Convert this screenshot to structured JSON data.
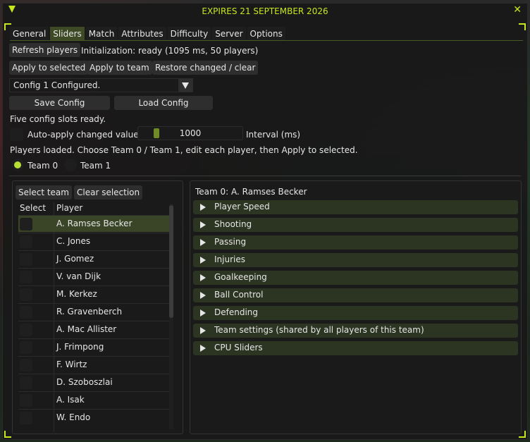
{
  "title": "EXPIRES 21 SEPTEMBER 2026",
  "tabs": [
    {
      "label": "General"
    },
    {
      "label": "Sliders"
    },
    {
      "label": "Match"
    },
    {
      "label": "Attributes"
    },
    {
      "label": "Difficulty"
    },
    {
      "label": "Server"
    },
    {
      "label": "Options"
    }
  ],
  "toolbar": {
    "refresh_label": "Refresh players",
    "init_status": "Initialization: ready (1095 ms, 50 players)",
    "apply_selected_label": "Apply to selected",
    "apply_team_label": "Apply to team",
    "restore_label": "Restore changed / clear"
  },
  "config": {
    "selected": "Config 1 Configured.",
    "save_label": "Save Config",
    "load_label": "Load Config",
    "status": "Five config slots ready."
  },
  "autoapply": {
    "label": "Auto-apply changed values",
    "interval_value": "1000",
    "interval_label": "Interval (ms)"
  },
  "hint": "Players loaded. Choose Team 0 / Team 1, edit each player, then Apply to selected.",
  "teams": {
    "team0": "Team 0",
    "team1": "Team 1"
  },
  "left_panel": {
    "select_team_label": "Select team",
    "clear_selection_label": "Clear selection",
    "col_select": "Select",
    "col_player": "Player",
    "players": [
      "A. Ramses Becker",
      "C. Jones",
      "J. Gomez",
      "V. van Dijk",
      "M. Kerkez",
      "R. Gravenberch",
      "A. Mac Allister",
      "J. Frimpong",
      "F. Wirtz",
      "D. Szoboszlai",
      "A. Isak",
      "W. Endo"
    ]
  },
  "right_panel": {
    "header": "Team 0: A. Ramses Becker",
    "sections": [
      "Player Speed",
      "Shooting",
      "Passing",
      "Injuries",
      "Goalkeeping",
      "Ball Control",
      "Defending",
      "Team settings (shared by all players of this team)",
      "CPU Sliders"
    ]
  },
  "colors": {
    "accent": "#c8e620",
    "tab_active": "#3d4a25",
    "section_bg": "#2c3422"
  }
}
